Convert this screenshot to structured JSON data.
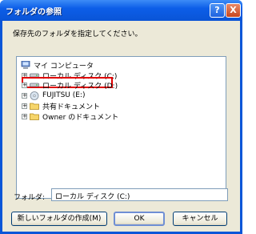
{
  "window": {
    "title": "フォルダの参照",
    "help_label": "?",
    "close_label": "X"
  },
  "instruction": "保存先のフォルダを指定してください。",
  "tree": {
    "items": [
      {
        "label": "マイ コンピュータ",
        "expander": "",
        "icon": "computer-icon"
      },
      {
        "label": "ローカル ディスク (C:)",
        "expander": "+",
        "icon": "drive-icon"
      },
      {
        "label": "ローカル ディスク (D:)",
        "expander": "+",
        "icon": "drive-icon",
        "highlighted": true
      },
      {
        "label": "FUJITSU (E:)",
        "expander": "+",
        "icon": "cd-drive-icon"
      },
      {
        "label": "共有ドキュメント",
        "expander": "+",
        "icon": "folder-icon"
      },
      {
        "label": "Owner のドキュメント",
        "expander": "+",
        "icon": "folder-icon"
      }
    ]
  },
  "folder": {
    "label": "フォルダ:",
    "value": "ローカル ディスク (C:)"
  },
  "buttons": {
    "new_folder": "新しいフォルダの作成(M)",
    "ok": "OK",
    "cancel": "キャンセル"
  },
  "colors": {
    "highlight_border": "#e00000",
    "titlebar": "#0a54d6"
  }
}
